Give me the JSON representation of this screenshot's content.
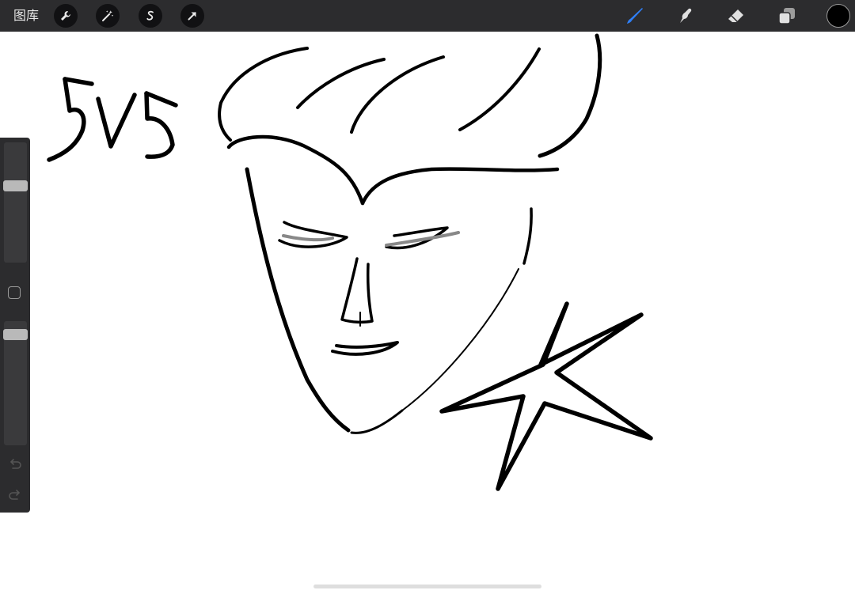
{
  "toolbar": {
    "gallery_label": "图库",
    "left_tools": [
      "wrench-icon",
      "magic-wand-icon",
      "selection-s-icon",
      "transform-arrow-icon"
    ],
    "right_tools": [
      "brush-icon",
      "smudge-icon",
      "eraser-icon",
      "layers-icon"
    ],
    "active_tool": "brush-icon",
    "accent_color": "#2f7ff6",
    "current_color": "#000000"
  },
  "sidebar": {
    "size_slider_level": 0.35,
    "opacity_slider_level": 0.07
  },
  "canvas": {
    "background": "#ffffff",
    "ink_color": "#000000",
    "handwritten_text": "5V5"
  }
}
